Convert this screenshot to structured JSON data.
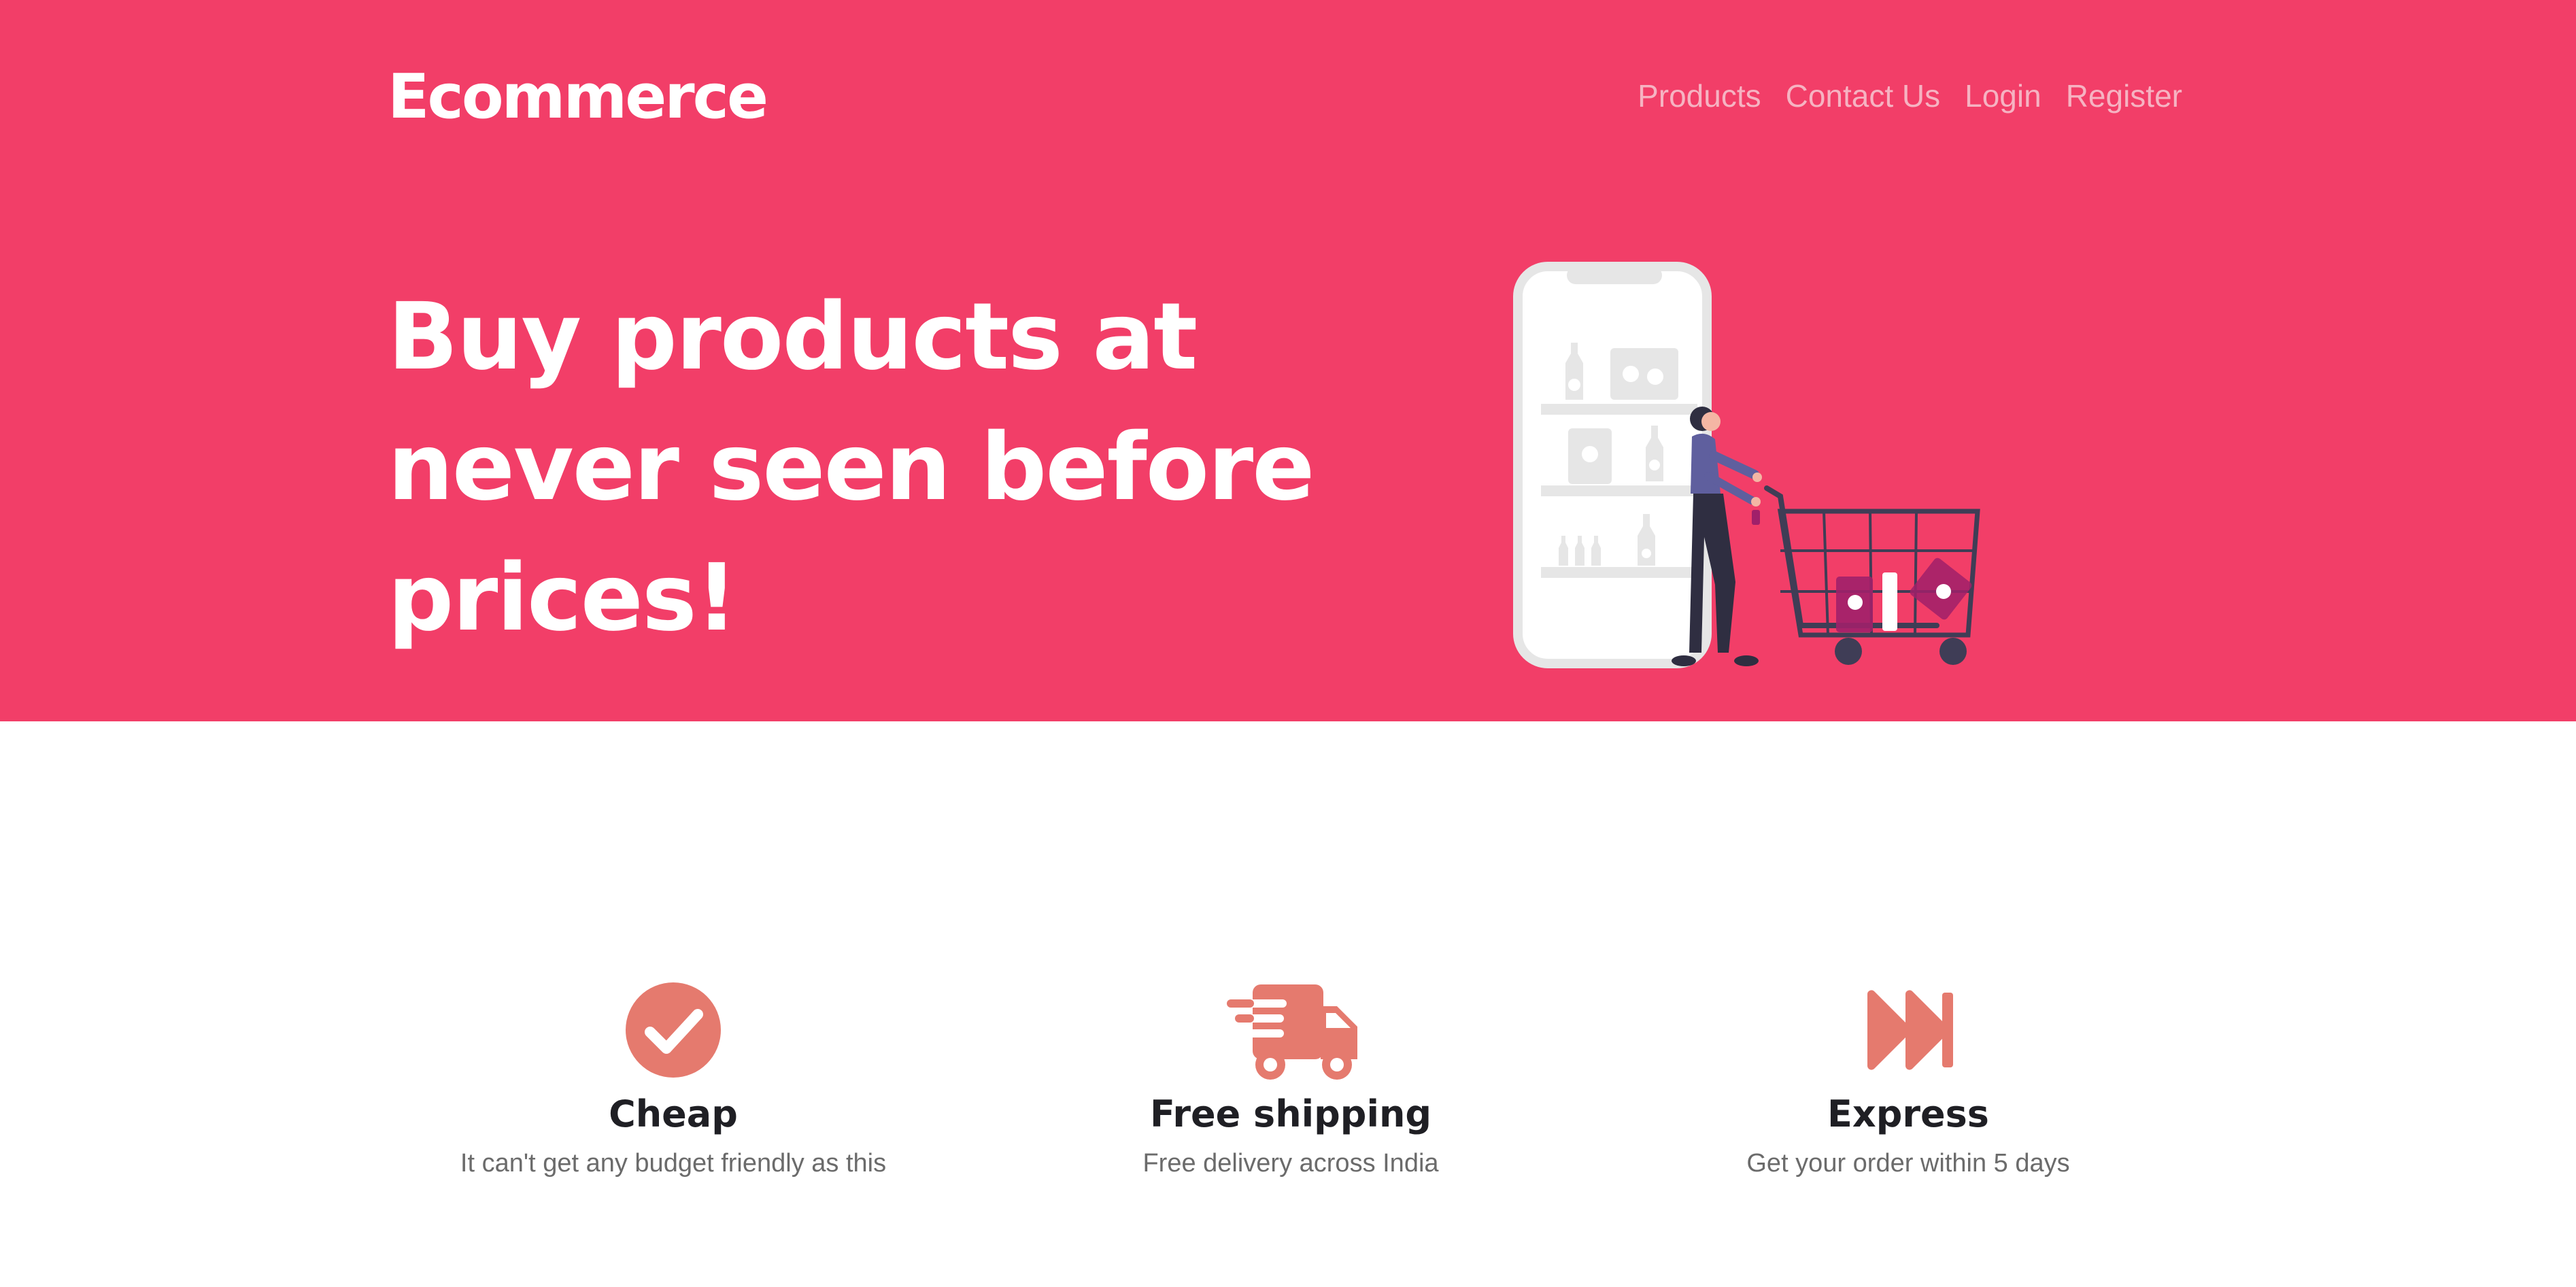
{
  "brand": "Ecommerce",
  "nav": {
    "products": "Products",
    "contact": "Contact Us",
    "login": "Login",
    "register": "Register"
  },
  "hero": {
    "headline_line1": "Buy products at",
    "headline_line2": "never seen before",
    "headline_line3": "prices!",
    "illustration": "shopping-cart-illustration"
  },
  "features": [
    {
      "icon": "check-circle-icon",
      "title": "Cheap",
      "description": "It can't get any budget friendly as this"
    },
    {
      "icon": "truck-icon",
      "title": "Free shipping",
      "description": "Free delivery across India"
    },
    {
      "icon": "fast-forward-icon",
      "title": "Express",
      "description": "Get your order within 5 days"
    }
  ],
  "colors": {
    "hero_bg": "#f23e68",
    "nav_link": "#f6b3c2",
    "accent_icon": "#e57a6e",
    "heading": "#1f1f24",
    "body_text": "#6b6b6b"
  }
}
